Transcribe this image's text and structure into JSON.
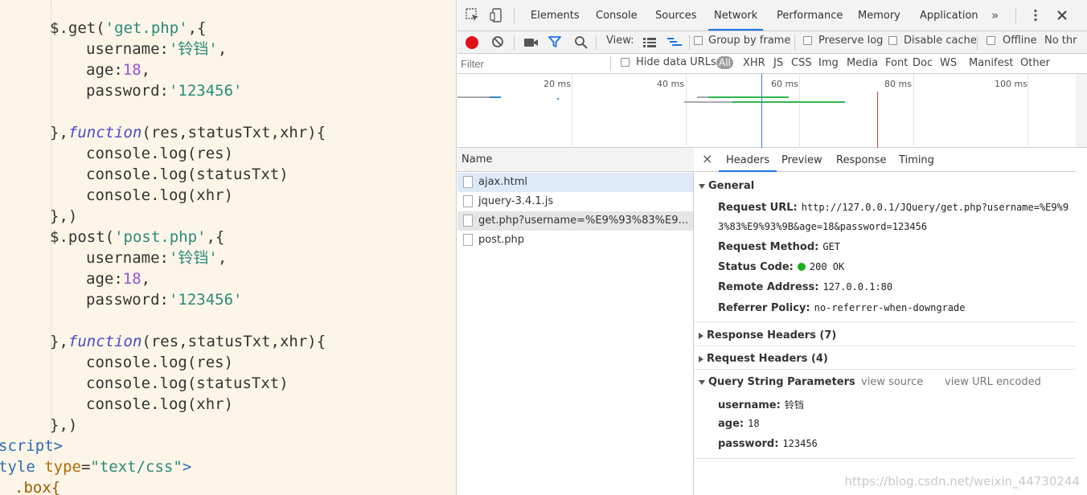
{
  "editor": {
    "code": [
      {
        "indent": 1,
        "parts": [
          [
            "$.get(",
            "p"
          ],
          [
            "'get.php'",
            "s"
          ],
          [
            ",{",
            "p"
          ]
        ]
      },
      {
        "indent": 2,
        "parts": [
          [
            "username:",
            "p"
          ],
          [
            "'铃铛'",
            "s"
          ],
          [
            ",",
            "p"
          ]
        ]
      },
      {
        "indent": 2,
        "parts": [
          [
            "age:",
            "p"
          ],
          [
            "18",
            "n"
          ],
          [
            ",",
            "p"
          ]
        ]
      },
      {
        "indent": 2,
        "parts": [
          [
            "password:",
            "p"
          ],
          [
            "'123456'",
            "s"
          ]
        ]
      },
      {
        "indent": 0,
        "parts": []
      },
      {
        "indent": 1,
        "parts": [
          [
            "},",
            "p"
          ],
          [
            "function",
            "k"
          ],
          [
            "(res,statusTxt,xhr){",
            "p"
          ]
        ]
      },
      {
        "indent": 2,
        "parts": [
          [
            "console.log(res)",
            "p"
          ]
        ]
      },
      {
        "indent": 2,
        "parts": [
          [
            "console.log(statusTxt)",
            "p"
          ]
        ]
      },
      {
        "indent": 2,
        "parts": [
          [
            "console.log(xhr)",
            "p"
          ]
        ]
      },
      {
        "indent": 1,
        "parts": [
          [
            "},)",
            "p"
          ]
        ]
      },
      {
        "indent": 1,
        "parts": [
          [
            "$.post(",
            "p"
          ],
          [
            "'post.php'",
            "s"
          ],
          [
            ",{",
            "p"
          ]
        ]
      },
      {
        "indent": 2,
        "parts": [
          [
            "username:",
            "p"
          ],
          [
            "'铃铛'",
            "s"
          ],
          [
            ",",
            "p"
          ]
        ]
      },
      {
        "indent": 2,
        "parts": [
          [
            "age:",
            "p"
          ],
          [
            "18",
            "n"
          ],
          [
            ",",
            "p"
          ]
        ]
      },
      {
        "indent": 2,
        "parts": [
          [
            "password:",
            "p"
          ],
          [
            "'123456'",
            "s"
          ]
        ]
      },
      {
        "indent": 0,
        "parts": []
      },
      {
        "indent": 1,
        "parts": [
          [
            "},",
            "p"
          ],
          [
            "function",
            "k"
          ],
          [
            "(res,statusTxt,xhr){",
            "p"
          ]
        ]
      },
      {
        "indent": 2,
        "parts": [
          [
            "console.log(res)",
            "p"
          ]
        ]
      },
      {
        "indent": 2,
        "parts": [
          [
            "console.log(statusTxt)",
            "p"
          ]
        ]
      },
      {
        "indent": 2,
        "parts": [
          [
            "console.log(xhr)",
            "p"
          ]
        ]
      },
      {
        "indent": 1,
        "parts": [
          [
            "},)",
            "p"
          ]
        ]
      },
      {
        "indent": -1,
        "parts": [
          [
            "script>",
            "t"
          ]
        ]
      },
      {
        "indent": -1,
        "parts": [
          [
            "tyle ",
            "t"
          ],
          [
            "type",
            "a"
          ],
          [
            "=",
            "p"
          ],
          [
            "\"text/css\"",
            "s"
          ],
          [
            ">",
            "t"
          ]
        ]
      },
      {
        "indent": 0,
        "parts": [
          [
            ".box{",
            "c"
          ]
        ]
      }
    ]
  },
  "devtools": {
    "tabs": [
      "Elements",
      "Console",
      "Sources",
      "Network",
      "Performance",
      "Memory",
      "Application"
    ],
    "active_tab": "Network",
    "more_tabs": "»",
    "toolbar": {
      "view_label": "View:",
      "group_by_frame": "Group by frame",
      "preserve_log": "Preserve log",
      "disable_cache": "Disable cache",
      "offline": "Offline",
      "throttle": "No thr"
    },
    "filter_bar": {
      "placeholder": "Filter",
      "hide_data_urls": "Hide data URLs",
      "types": [
        "All",
        "XHR",
        "JS",
        "CSS",
        "Img",
        "Media",
        "Font",
        "Doc",
        "WS",
        "Manifest",
        "Other"
      ],
      "active_type": "All"
    },
    "overview": {
      "ticks": [
        "20 ms",
        "40 ms",
        "60 ms",
        "80 ms",
        "100 ms"
      ]
    },
    "requests": {
      "header": "Name",
      "rows": [
        "ajax.html",
        "jquery-3.4.1.js",
        "get.php?username=%E9%93%83%E9%93...",
        "post.php"
      ]
    },
    "details": {
      "close": "×",
      "tabs": [
        "Headers",
        "Preview",
        "Response",
        "Timing"
      ],
      "active_tab": "Headers",
      "general": {
        "title": "General",
        "request_url_label": "Request URL:",
        "request_url_line1": "http://127.0.0.1/JQuery/get.php?username=%E9%9",
        "request_url_line2": "3%83%E9%93%9B&age=18&password=123456",
        "request_method_label": "Request Method:",
        "request_method": "GET",
        "status_code_label": "Status Code:",
        "status_code": "200 OK",
        "remote_address_label": "Remote Address:",
        "remote_address": "127.0.0.1:80",
        "referrer_policy_label": "Referrer Policy:",
        "referrer_policy": "no-referrer-when-downgrade"
      },
      "response_headers": "Response Headers (7)",
      "request_headers": "Request Headers (4)",
      "query_params": {
        "title": "Query String Parameters",
        "view_source": "view source",
        "view_url_encoded": "view URL encoded",
        "params": [
          {
            "key": "username:",
            "value": "铃铛"
          },
          {
            "key": "age:",
            "value": "18"
          },
          {
            "key": "password:",
            "value": "123456"
          }
        ]
      }
    },
    "watermark": "https://blog.csdn.net/weixin_44730244"
  }
}
